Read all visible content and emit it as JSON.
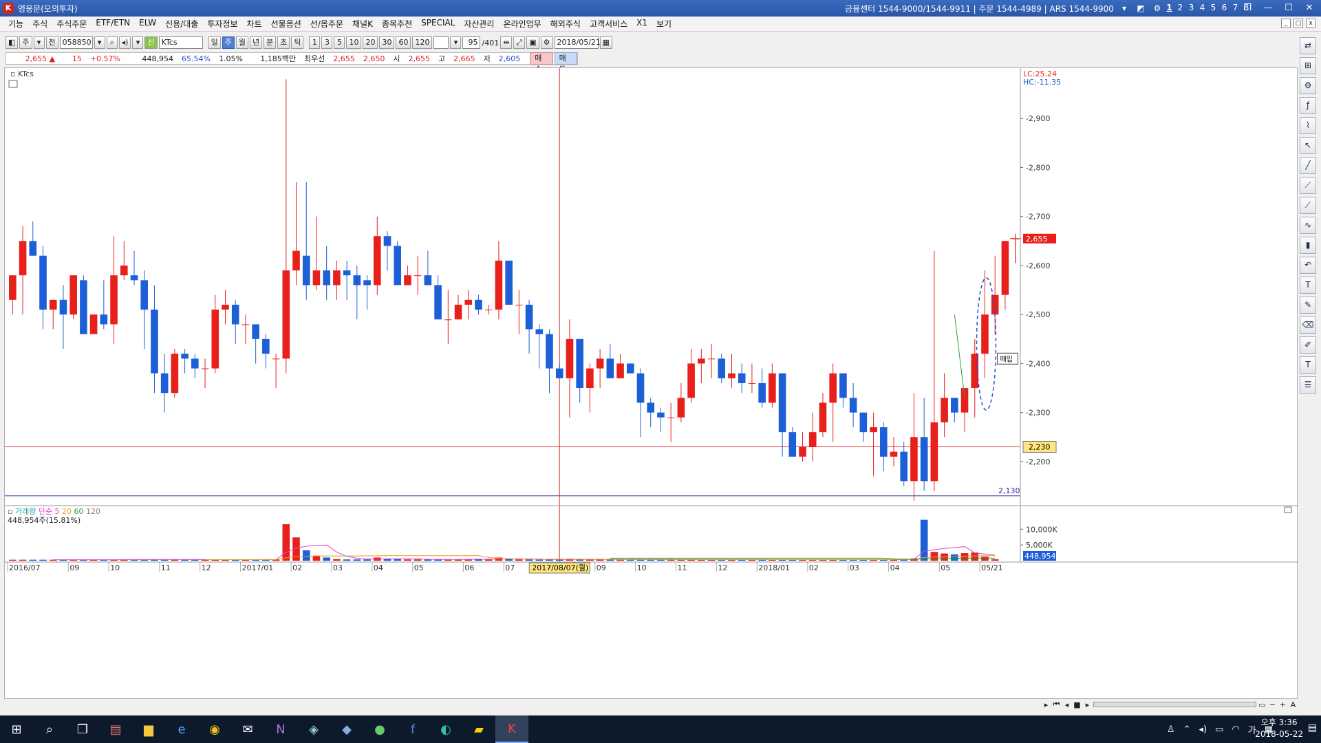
{
  "titlebar": {
    "title": "영웅문(모의투자)",
    "info": "금융센터 1544-9000/1544-9911  |  주문 1544-4989  |  ARS 1544-9900",
    "screens": [
      "1",
      "2",
      "3",
      "4",
      "5",
      "6",
      "7",
      "8"
    ]
  },
  "menu": [
    "기능",
    "주식",
    "주식주문",
    "ETF/ETN",
    "ELW",
    "신용/대출",
    "투자정보",
    "차트",
    "선물옵션",
    "선/옵주문",
    "채널K",
    "종목추천",
    "SPECIAL",
    "자산관리",
    "온라인업무",
    "해외주식",
    "고객서비스",
    "X1",
    "보기"
  ],
  "toolbar": {
    "period_main": "주",
    "compare": "전",
    "code": "058850",
    "name": "KTcs",
    "periods": [
      "일",
      "주",
      "월",
      "년",
      "분",
      "초",
      "틱"
    ],
    "active_period": "주",
    "intervals": [
      "1",
      "3",
      "5",
      "10",
      "20",
      "30",
      "60",
      "120"
    ],
    "count": "95",
    "count_total": "/401",
    "date": "2018/05/21"
  },
  "quote": {
    "price": "2,655",
    "change": "15",
    "change_pct": "+0.57%",
    "volume": "448,954",
    "vol_ratio": "65.54%",
    "turnover": "1.05%",
    "amount": "1,185백만",
    "best_label": "최우선",
    "best_ask": "2,655",
    "best_bid": "2,650",
    "open_label": "시",
    "open": "2,655",
    "high_label": "고",
    "high": "2,665",
    "low_label": "저",
    "low": "2,605",
    "buy": "매수",
    "sell": "매도"
  },
  "chart_labels": {
    "name_tag": "KTcs",
    "lc": "LC:25.24",
    "hc": "HC:-11.35",
    "price_tag": "2,655",
    "crosshair_price": "2,230",
    "low_line_price": "2,130",
    "crosshair_date": "2017/08/07(월)",
    "annotation": "매입",
    "volume_title": "거래량",
    "ma_label": "단순",
    "ma_periods": [
      "5",
      "20",
      "60",
      "120"
    ],
    "volume_value": "448,954주(15.81%)",
    "volume_tag": "448,954"
  },
  "colors": {
    "up": "#e8201c",
    "down": "#1c5fd6",
    "crosshair": "#e03030",
    "low_line": "#2a2aa0",
    "ma5": "#e040d0",
    "ma20": "#e0a020",
    "ma60": "#20a040",
    "ma120": "#808080"
  },
  "chart_data": [
    {
      "type": "candlestick",
      "title": "KTcs",
      "period": "weekly",
      "ylim": [
        2110,
        3000
      ],
      "yticks": [
        2200,
        2300,
        2400,
        2500,
        2600,
        2700,
        2800,
        2900
      ],
      "xticks": [
        {
          "i": 0,
          "label": "2016/07"
        },
        {
          "i": 6,
          "label": "09"
        },
        {
          "i": 10,
          "label": "10"
        },
        {
          "i": 15,
          "label": "11"
        },
        {
          "i": 19,
          "label": "12"
        },
        {
          "i": 23,
          "label": "2017/01"
        },
        {
          "i": 28,
          "label": "02"
        },
        {
          "i": 32,
          "label": "03"
        },
        {
          "i": 36,
          "label": "04"
        },
        {
          "i": 40,
          "label": "05"
        },
        {
          "i": 45,
          "label": "06"
        },
        {
          "i": 49,
          "label": "07"
        },
        {
          "i": 58,
          "label": "09"
        },
        {
          "i": 62,
          "label": "10"
        },
        {
          "i": 66,
          "label": "11"
        },
        {
          "i": 70,
          "label": "12"
        },
        {
          "i": 74,
          "label": "2018/01"
        },
        {
          "i": 79,
          "label": "02"
        },
        {
          "i": 83,
          "label": "03"
        },
        {
          "i": 87,
          "label": "04"
        },
        {
          "i": 92,
          "label": "05"
        },
        {
          "i": 96,
          "label": "05/21"
        }
      ],
      "crosshair_index": 54,
      "crosshair_price": 2230,
      "low_line": 2130,
      "candles": [
        [
          2530,
          2580,
          2500,
          2580
        ],
        [
          2580,
          2680,
          2500,
          2650
        ],
        [
          2650,
          2690,
          2620,
          2620
        ],
        [
          2620,
          2640,
          2470,
          2510
        ],
        [
          2510,
          2530,
          2470,
          2530
        ],
        [
          2530,
          2560,
          2430,
          2500
        ],
        [
          2500,
          2580,
          2490,
          2580
        ],
        [
          2570,
          2580,
          2490,
          2460
        ],
        [
          2460,
          2500,
          2470,
          2500
        ],
        [
          2500,
          2570,
          2470,
          2480
        ],
        [
          2480,
          2660,
          2440,
          2580
        ],
        [
          2580,
          2650,
          2570,
          2600
        ],
        [
          2580,
          2630,
          2560,
          2570
        ],
        [
          2570,
          2590,
          2430,
          2510
        ],
        [
          2510,
          2560,
          2340,
          2380
        ],
        [
          2380,
          2420,
          2300,
          2340
        ],
        [
          2340,
          2430,
          2330,
          2420
        ],
        [
          2420,
          2430,
          2380,
          2410
        ],
        [
          2410,
          2420,
          2370,
          2390
        ],
        [
          2390,
          2410,
          2350,
          2390
        ],
        [
          2390,
          2540,
          2380,
          2510
        ],
        [
          2510,
          2550,
          2480,
          2520
        ],
        [
          2520,
          2530,
          2440,
          2480
        ],
        [
          2480,
          2500,
          2440,
          2480
        ],
        [
          2480,
          2480,
          2400,
          2450
        ],
        [
          2450,
          2460,
          2390,
          2420
        ],
        [
          2410,
          2420,
          2350,
          2410
        ],
        [
          2410,
          2980,
          2380,
          2590
        ],
        [
          2590,
          2770,
          2560,
          2630
        ],
        [
          2620,
          2770,
          2530,
          2560
        ],
        [
          2560,
          2700,
          2550,
          2590
        ],
        [
          2590,
          2640,
          2530,
          2560
        ],
        [
          2560,
          2610,
          2530,
          2590
        ],
        [
          2590,
          2610,
          2530,
          2580
        ],
        [
          2580,
          2600,
          2490,
          2560
        ],
        [
          2570,
          2580,
          2510,
          2560
        ],
        [
          2560,
          2700,
          2540,
          2660
        ],
        [
          2660,
          2670,
          2590,
          2640
        ],
        [
          2640,
          2650,
          2560,
          2560
        ],
        [
          2560,
          2600,
          2560,
          2580
        ],
        [
          2580,
          2620,
          2540,
          2580
        ],
        [
          2580,
          2630,
          2560,
          2560
        ],
        [
          2560,
          2580,
          2490,
          2490
        ],
        [
          2490,
          2550,
          2440,
          2490
        ],
        [
          2490,
          2540,
          2490,
          2520
        ],
        [
          2520,
          2550,
          2490,
          2530
        ],
        [
          2530,
          2540,
          2500,
          2510
        ],
        [
          2510,
          2520,
          2500,
          2510
        ],
        [
          2510,
          2650,
          2490,
          2610
        ],
        [
          2610,
          2610,
          2520,
          2520
        ],
        [
          2520,
          2550,
          2460,
          2520
        ],
        [
          2520,
          2530,
          2420,
          2470
        ],
        [
          2470,
          2480,
          2390,
          2460
        ],
        [
          2460,
          2470,
          2340,
          2390
        ],
        [
          2390,
          2400,
          2380,
          2370
        ],
        [
          2370,
          2490,
          2290,
          2450
        ],
        [
          2450,
          2450,
          2320,
          2350
        ],
        [
          2350,
          2400,
          2300,
          2390
        ],
        [
          2390,
          2430,
          2350,
          2410
        ],
        [
          2410,
          2440,
          2370,
          2370
        ],
        [
          2370,
          2420,
          2370,
          2400
        ],
        [
          2400,
          2400,
          2380,
          2380
        ],
        [
          2380,
          2390,
          2250,
          2320
        ],
        [
          2320,
          2330,
          2270,
          2300
        ],
        [
          2300,
          2310,
          2260,
          2290
        ],
        [
          2290,
          2320,
          2240,
          2290
        ],
        [
          2290,
          2360,
          2280,
          2330
        ],
        [
          2330,
          2430,
          2320,
          2400
        ],
        [
          2400,
          2430,
          2360,
          2410
        ],
        [
          2410,
          2440,
          2370,
          2410
        ],
        [
          2410,
          2420,
          2360,
          2370
        ],
        [
          2370,
          2420,
          2350,
          2380
        ],
        [
          2380,
          2400,
          2340,
          2360
        ],
        [
          2360,
          2400,
          2340,
          2360
        ],
        [
          2360,
          2390,
          2310,
          2320
        ],
        [
          2320,
          2400,
          2310,
          2380
        ],
        [
          2380,
          2380,
          2210,
          2260
        ],
        [
          2260,
          2270,
          2210,
          2210
        ],
        [
          2210,
          2260,
          2200,
          2230
        ],
        [
          2230,
          2300,
          2200,
          2260
        ],
        [
          2260,
          2340,
          2250,
          2320
        ],
        [
          2320,
          2400,
          2240,
          2380
        ],
        [
          2380,
          2380,
          2310,
          2330
        ],
        [
          2330,
          2360,
          2270,
          2300
        ],
        [
          2300,
          2300,
          2240,
          2260
        ],
        [
          2260,
          2300,
          2170,
          2270
        ],
        [
          2270,
          2280,
          2180,
          2210
        ],
        [
          2210,
          2250,
          2190,
          2220
        ],
        [
          2220,
          2240,
          2150,
          2160
        ],
        [
          2160,
          2340,
          2120,
          2250
        ],
        [
          2250,
          2330,
          2140,
          2160
        ],
        [
          2160,
          2630,
          2140,
          2280
        ],
        [
          2280,
          2380,
          2250,
          2330
        ],
        [
          2330,
          2330,
          2280,
          2300
        ],
        [
          2300,
          2330,
          2260,
          2350
        ],
        [
          2350,
          2450,
          2290,
          2420
        ],
        [
          2420,
          2590,
          2370,
          2500
        ],
        [
          2500,
          2620,
          2460,
          2540
        ],
        [
          2540,
          2650,
          2510,
          2650
        ],
        [
          2655,
          2665,
          2605,
          2655
        ]
      ]
    },
    {
      "type": "bar",
      "title": "거래량",
      "ylim": [
        0,
        14000
      ],
      "yticks": [
        5000,
        10000
      ],
      "ytick_labels": [
        "5,000K",
        "10,000K"
      ],
      "values": [
        300,
        300,
        300,
        300,
        300,
        300,
        300,
        300,
        300,
        300,
        350,
        350,
        350,
        350,
        350,
        350,
        350,
        350,
        350,
        350,
        350,
        350,
        350,
        350,
        350,
        350,
        350,
        11600,
        7400,
        3300,
        1600,
        1000,
        500,
        400,
        400,
        400,
        1000,
        600,
        500,
        400,
        400,
        400,
        400,
        400,
        400,
        500,
        600,
        400,
        1000,
        600,
        400,
        400,
        350,
        350,
        350,
        600,
        400,
        350,
        350,
        350,
        350,
        350,
        350,
        350,
        350,
        350,
        350,
        350,
        350,
        350,
        350,
        350,
        350,
        350,
        350,
        350,
        350,
        350,
        350,
        350,
        350,
        350,
        350,
        350,
        350,
        350,
        350,
        350,
        600,
        700,
        13000,
        2800,
        2300,
        2000,
        2400,
        2600,
        1300,
        449
      ]
    }
  ]
}
